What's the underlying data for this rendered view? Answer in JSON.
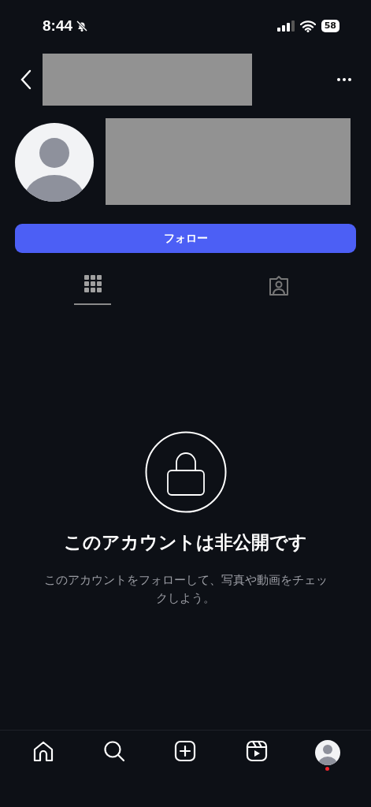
{
  "status_bar": {
    "time": "8:44",
    "muted": true,
    "battery": "58"
  },
  "profile": {
    "follow_button": "フォロー"
  },
  "tabs": [
    {
      "kind": "grid",
      "selected": true
    },
    {
      "kind": "tagged",
      "selected": false
    }
  ],
  "private_notice": {
    "title": "このアカウントは非公開です",
    "message": "このアカウントをフォローして、写真や動画をチェックしよう。"
  },
  "bottom_nav": [
    {
      "kind": "home",
      "notification": false
    },
    {
      "kind": "search",
      "notification": false
    },
    {
      "kind": "create",
      "notification": false
    },
    {
      "kind": "reels",
      "notification": false
    },
    {
      "kind": "profile",
      "notification": true
    }
  ]
}
